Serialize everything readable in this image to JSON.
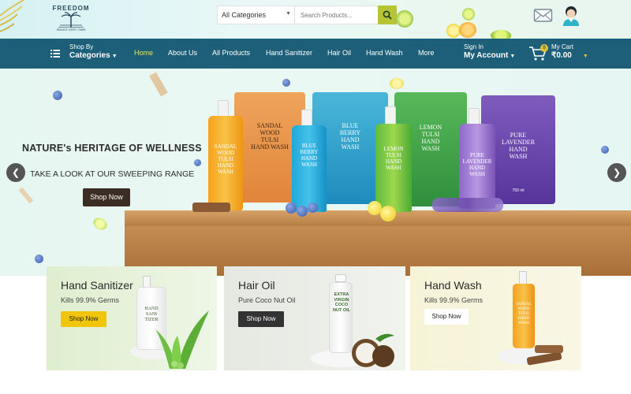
{
  "brand": {
    "name": "FREEDOM",
    "tagline": "INDIA'S VERY OWN"
  },
  "search": {
    "category_value": "All Categories",
    "placeholder": "Search Products...",
    "button_icon": "search-icon"
  },
  "header_icons": [
    "mail-icon",
    "user-avatar"
  ],
  "nav": {
    "shop_by_small": "Shop By",
    "shop_by_big": "Categories",
    "links": [
      {
        "label": "Home",
        "active": true
      },
      {
        "label": "About Us",
        "active": false
      },
      {
        "label": "All Products",
        "active": false
      },
      {
        "label": "Hand Sanitizer",
        "active": false
      },
      {
        "label": "Hair Oil",
        "active": false
      },
      {
        "label": "Hand Wash",
        "active": false
      },
      {
        "label": "More",
        "active": false
      }
    ],
    "signin_small": "Sign In",
    "signin_big": "My Account",
    "cart_small": "My Cart",
    "cart_total": "₹0.00",
    "cart_count": "0"
  },
  "hero": {
    "heading": "NATURE's HERITAGE OF WELLNESS",
    "subheading": "TAKE A LOOK AT OUR SWEEPING RANGE",
    "button": "Shop Now",
    "prev_icon": "chevron-left-icon",
    "next_icon": "chevron-right-icon",
    "products": [
      {
        "line1": "SANDAL",
        "line2": "WOOD",
        "line3": "TULSI",
        "line4": "HAND WASH"
      },
      {
        "line1": "BLUE",
        "line2": "BERRY",
        "line3": "HAND",
        "line4": "WASH"
      },
      {
        "line1": "LEMON",
        "line2": "TULSI",
        "line3": "HAND",
        "line4": "WASH"
      },
      {
        "line1": "PURE",
        "line2": "LAVENDER",
        "line3": "HAND",
        "line4": "WASH"
      }
    ],
    "bottles": [
      {
        "line1": "SANDAL",
        "line2": "WOOD",
        "line3": "TULSI",
        "line4": "HAND",
        "line5": "WASH"
      },
      {
        "line1": "BLUE",
        "line2": "BERRY",
        "line3": "HAND",
        "line4": "WASH"
      },
      {
        "line1": "LEMON",
        "line2": "TULSI",
        "line3": "HAND",
        "line4": "WASH"
      },
      {
        "line1": "PURE",
        "line2": "LAVENDER",
        "line3": "HAND",
        "line4": "WASH"
      }
    ],
    "volume": "750 ml"
  },
  "categories": [
    {
      "title": "Hand Sanitizer",
      "subtitle": "Kills 99.9% Germs",
      "button": "Shop Now",
      "bottle_text": "HAND SANI TIZER",
      "bg": "#e4f1d9",
      "btn_bg": "#f1c50c",
      "btn_color": "#222222"
    },
    {
      "title": "Hair Oil",
      "subtitle": "Pure Coco Nut Oil",
      "button": "Shop Now",
      "bottle_text": "EXTRA VIRGIN COCO NUT OIL",
      "bg": "#e9ece5",
      "btn_bg": "#333333",
      "btn_color": "#ffffff"
    },
    {
      "title": "Hand Wash",
      "subtitle": "Kills 99.9% Germs",
      "button": "Shop Now",
      "bottle_text": "SANDAL WOOD TULSI HAND WASH",
      "bg": "#f6f4dc",
      "btn_bg": "#ffffff",
      "btn_color": "#222222"
    }
  ],
  "colors": {
    "nav_bg": "#1d5f79",
    "nav_active": "#e7ea5a",
    "search_btn": "#b7c435",
    "hero_btn": "#3b2c24"
  }
}
